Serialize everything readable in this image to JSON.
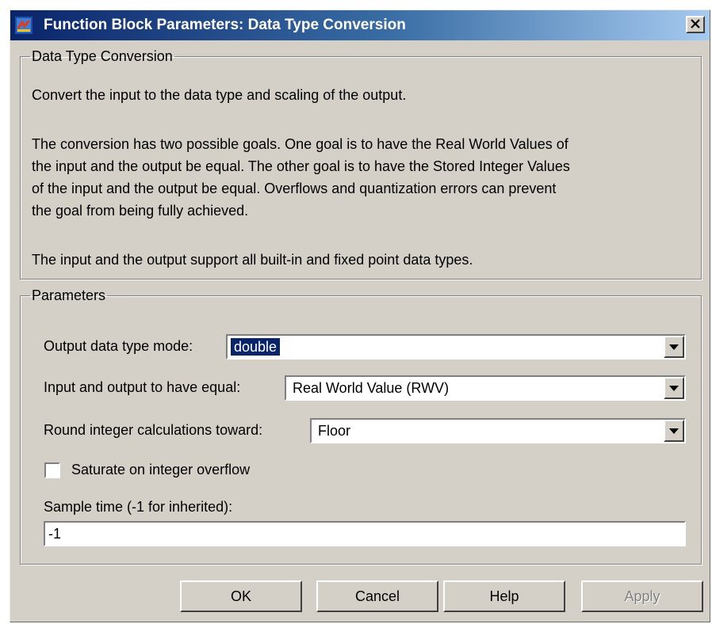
{
  "window": {
    "title": "Function Block Parameters: Data Type Conversion"
  },
  "description": {
    "group_label": "Data Type Conversion",
    "lines": [
      "Convert the input to the data type and scaling of the output.",
      "The conversion has two possible goals. One goal is to have the Real World Values of",
      "the input and the output be equal.  The other goal is to have the Stored Integer Values",
      "of the input and the output be equal.  Overflows and quantization errors can prevent",
      "the goal from being fully achieved.",
      "The input and the output support all built-in and fixed point data types."
    ]
  },
  "parameters": {
    "group_label": "Parameters",
    "output_mode": {
      "label": "Output data type mode:",
      "value": "double"
    },
    "equal": {
      "label": "Input and output to have equal:",
      "value": "Real World Value (RWV)"
    },
    "round": {
      "label": "Round integer calculations toward:",
      "value": "Floor"
    },
    "saturate": {
      "label": "Saturate on integer overflow",
      "checked": false
    },
    "sample_time": {
      "label": "Sample time (-1 for inherited):",
      "value": "-1"
    }
  },
  "buttons": {
    "ok": "OK",
    "cancel": "Cancel",
    "help": "Help",
    "apply": "Apply"
  },
  "colors": {
    "titlebar_start": "#0a246a",
    "titlebar_end": "#a6caf0",
    "dialog_face": "#d4d0c8",
    "selection": "#0a246a"
  },
  "icons": {
    "title": "simulink-block-icon",
    "close": "close-x-icon",
    "dropdown": "dropdown-arrow-icon"
  }
}
